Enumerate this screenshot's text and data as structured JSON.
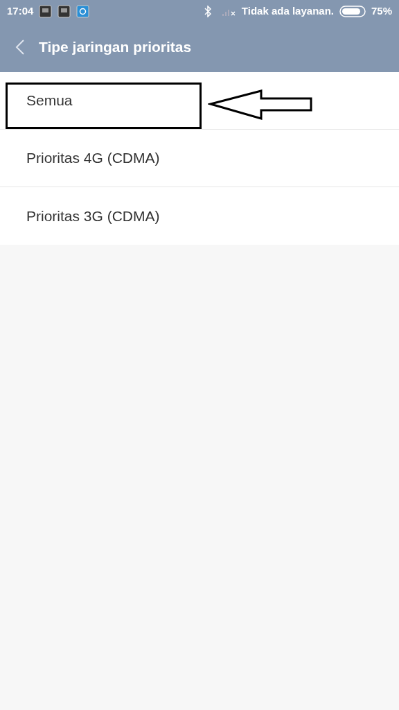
{
  "status_bar": {
    "time": "17:04",
    "carrier": "Tidak ada layanan.",
    "battery": "75%"
  },
  "header": {
    "title": "Tipe jaringan prioritas"
  },
  "options": [
    {
      "label": "Semua",
      "highlighted": true
    },
    {
      "label": "Prioritas 4G (CDMA)",
      "highlighted": false
    },
    {
      "label": "Prioritas 3G (CDMA)",
      "highlighted": false
    }
  ]
}
